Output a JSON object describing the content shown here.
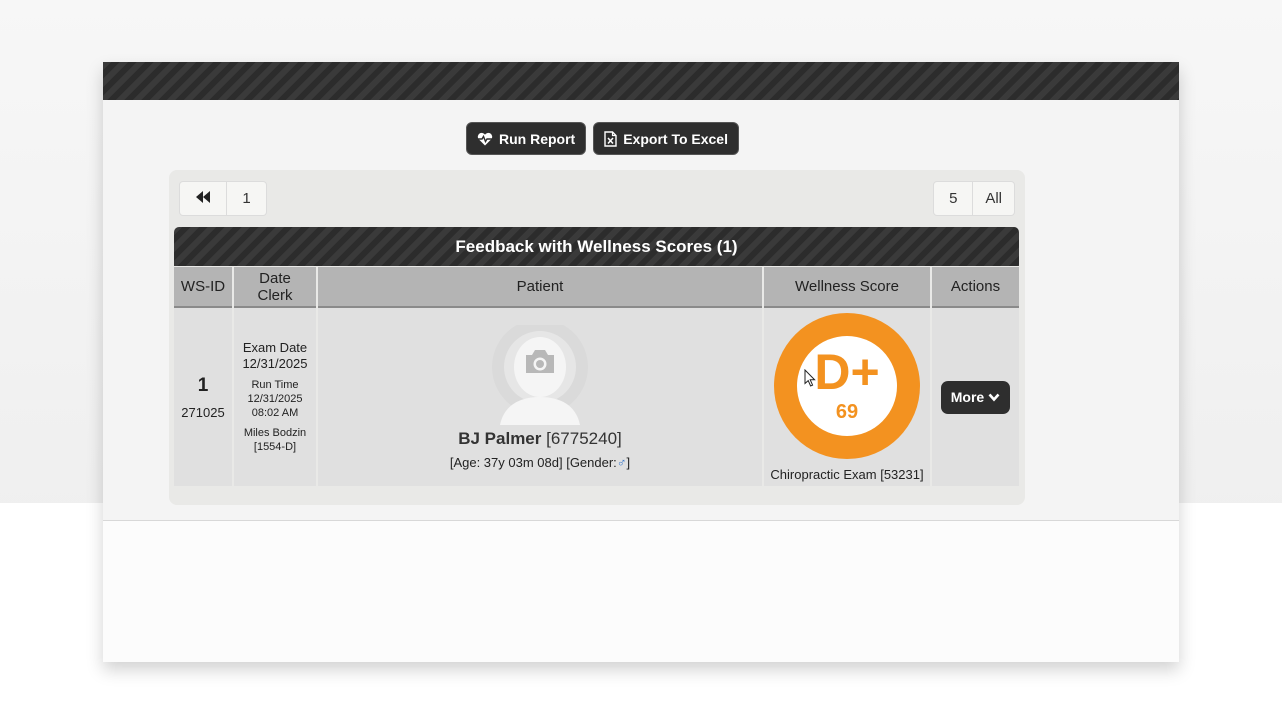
{
  "toolbar": {
    "run_report_label": "Run Report",
    "export_label": "Export To Excel"
  },
  "pager": {
    "first_icon": "double-chevron-left-icon",
    "current_page": "1",
    "page_size": "5",
    "all_label": "All"
  },
  "grid": {
    "title": "Feedback with Wellness Scores (1)",
    "columns": {
      "wsid": "WS-ID",
      "date_line1": "Date",
      "date_line2": "Clerk",
      "patient": "Patient",
      "score": "Wellness Score",
      "actions": "Actions"
    },
    "rows": [
      {
        "ws_id": "1",
        "ws_sub": "271025",
        "exam_date_label": "Exam Date",
        "exam_date": "12/31/2025",
        "run_time_label": "Run Time",
        "run_time_date": "12/31/2025",
        "run_time_time": "08:02 AM",
        "clerk_name": "Miles Bodzin",
        "clerk_id": "[1554-D]",
        "patient_name": "BJ Palmer",
        "patient_id": "[6775240]",
        "patient_age": "[Age: 37y 03m 08d]",
        "gender_label": "[Gender:",
        "gender_symbol": "♂",
        "gender_close": "]",
        "grade": "D+",
        "score": "69",
        "score_color": "#f39220",
        "exam_label": "Chiropractic Exam [53231]",
        "more_label": "More"
      }
    ]
  }
}
